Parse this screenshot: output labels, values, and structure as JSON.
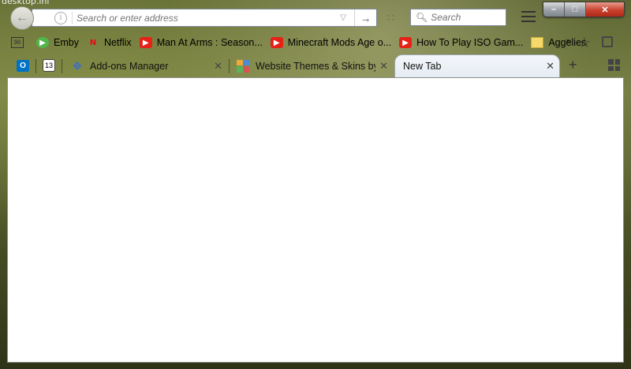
{
  "desktop": {
    "label": "desktop.ini"
  },
  "window": {
    "controls": {
      "minimize_icon": "minimize-icon",
      "maximize_icon": "maximize-icon",
      "close_icon": "close-icon"
    }
  },
  "navbar": {
    "address_placeholder": "Search or enter address",
    "search_placeholder": "Search"
  },
  "bookmarks": [
    {
      "label": "",
      "icon": "mail-icon"
    },
    {
      "label": "Emby",
      "icon": "emby-icon"
    },
    {
      "label": "Netflix",
      "icon": "netflix-icon"
    },
    {
      "label": "Man At Arms : Season...",
      "icon": "youtube-icon"
    },
    {
      "label": "Minecraft Mods Age o...",
      "icon": "youtube-icon"
    },
    {
      "label": "How To Play ISO Gam...",
      "icon": "youtube-icon"
    },
    {
      "label": "Aggelies",
      "icon": "folder-icon"
    }
  ],
  "app_tabs": [
    {
      "icon": "outlook-icon",
      "label": "O"
    },
    {
      "icon": "calendar-icon",
      "label": "13"
    }
  ],
  "tabs": [
    {
      "label": "Add-ons Manager",
      "icon": "puzzle-icon",
      "selected": false
    },
    {
      "label": "Website Themes & Skins by S",
      "icon": "themes-icon",
      "selected": false
    },
    {
      "label": "New Tab",
      "icon": "",
      "selected": true
    }
  ]
}
